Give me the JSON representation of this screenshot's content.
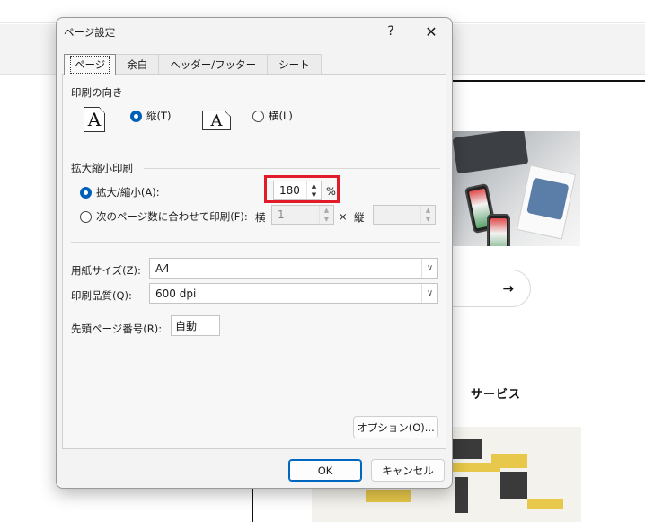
{
  "background": {
    "arrow_glyph": "→",
    "section_heading": "サービス"
  },
  "dialog": {
    "title": "ページ設定",
    "help_label": "?",
    "close_label": "✕",
    "tabs": [
      {
        "label": "ページ",
        "active": true
      },
      {
        "label": "余白",
        "active": false
      },
      {
        "label": "ヘッダー/フッター",
        "active": false
      },
      {
        "label": "シート",
        "active": false
      }
    ],
    "orientation": {
      "group_label": "印刷の向き",
      "portrait_icon_letter": "A",
      "landscape_icon_letter": "A",
      "portrait_label": "縦(T)",
      "landscape_label": "横(L)",
      "selected": "portrait"
    },
    "scaling": {
      "group_label": "拡大縮小印刷",
      "adjust_label": "拡大/縮小(A):",
      "adjust_value": "180",
      "percent_sign": "%",
      "fit_label": "次のページ数に合わせて印刷(F):",
      "fit_wide_label": "横",
      "fit_wide_value": "1",
      "times_sign": "×",
      "fit_tall_label": "縦",
      "fit_tall_value": "",
      "selected": "adjust"
    },
    "paper_size": {
      "label": "用紙サイズ(Z):",
      "value": "A4"
    },
    "print_quality": {
      "label": "印刷品質(Q):",
      "value": "600 dpi"
    },
    "first_page_number": {
      "label": "先頭ページ番号(R):",
      "value": "自動"
    },
    "options_button": "オプション(O)...",
    "ok_button": "OK",
    "cancel_button": "キャンセル",
    "colors": {
      "accent": "#005fb8",
      "highlight_box": "#e21b2b"
    }
  }
}
